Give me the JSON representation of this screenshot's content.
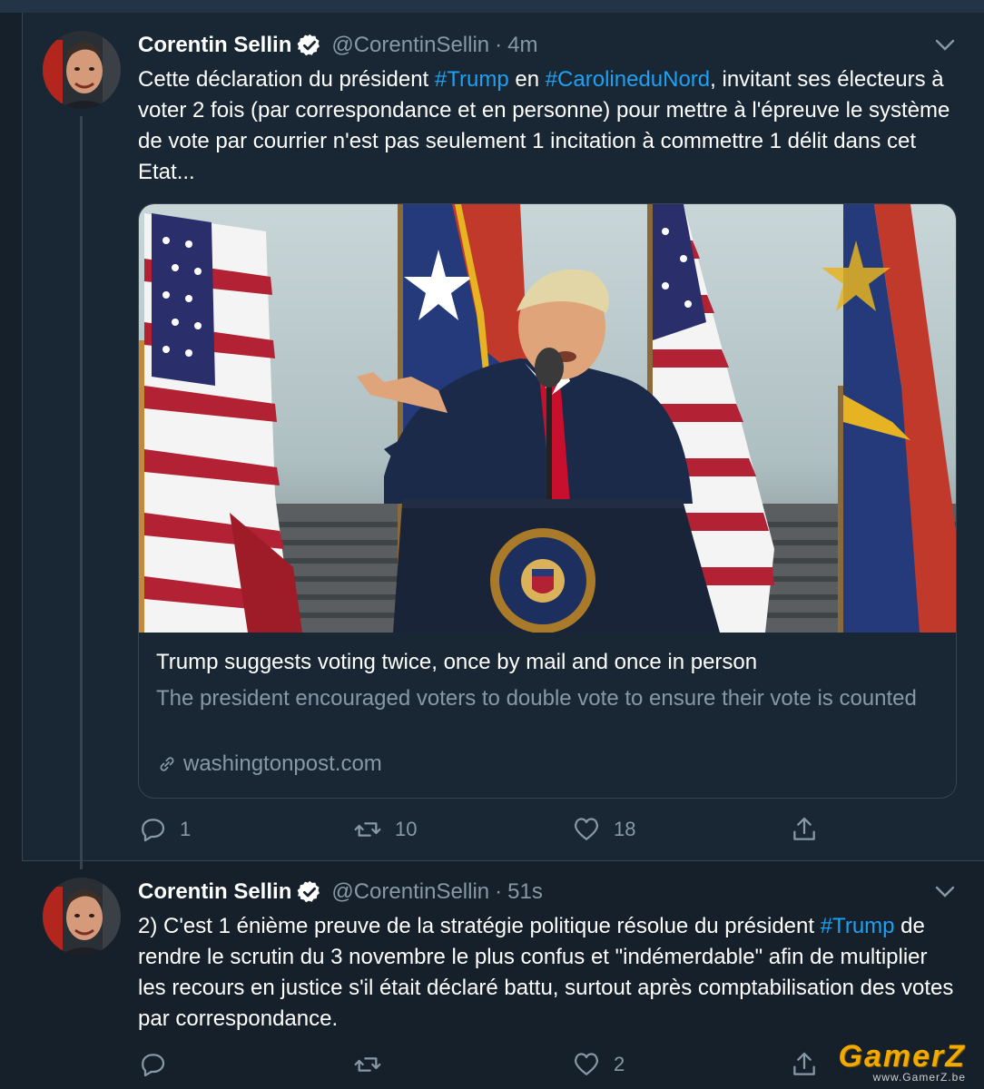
{
  "colors": {
    "background": "#15202b",
    "accent": "#1da1f2",
    "secondary_text": "#8899a6",
    "border": "#38444d"
  },
  "tweets": [
    {
      "author_name": "Corentin Sellin",
      "handle": "@CorentinSellin",
      "separator": "·",
      "time": "4m",
      "text": {
        "p1": "Cette déclaration du président ",
        "tag1": "#Trump",
        "p2": " en ",
        "tag2": "#CarolineduNord",
        "p3": ", invitant ses électeurs à voter 2 fois (par correspondance et en personne) pour mettre à l'épreuve le système de vote par courrier n'est pas seulement 1 incitation à commettre 1 délit dans cet Etat..."
      },
      "link_card": {
        "image_icon": "news-photo-image",
        "title": "Trump suggests voting twice, once by mail and once in person",
        "description": "The president encouraged voters to double vote to ensure their vote is counted",
        "domain": "washingtonpost.com"
      },
      "actions": {
        "replies": "1",
        "retweets": "10",
        "likes": "18"
      }
    },
    {
      "author_name": "Corentin Sellin",
      "handle": "@CorentinSellin",
      "separator": "·",
      "time": "51s",
      "text": {
        "p1": "2) C'est 1 énième preuve de la stratégie politique résolue du président ",
        "tag1": "#Trump",
        "p2": " de rendre le scrutin du 3 novembre le plus confus et \"indémerdable\" afin de multiplier les recours en justice s'il était déclaré battu, surtout après comptabilisation des votes par correspondance."
      },
      "actions": {
        "replies": "",
        "retweets": "",
        "likes": "2"
      }
    }
  ],
  "watermark": {
    "main": "GamerZ",
    "sub": "www.GamerZ.be"
  }
}
